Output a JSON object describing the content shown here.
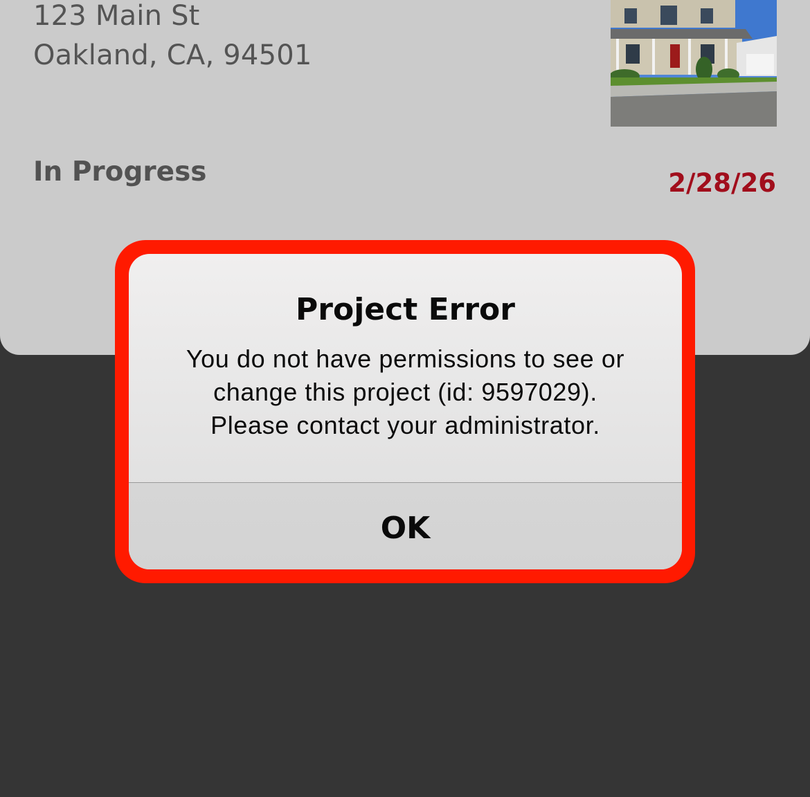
{
  "project_card": {
    "address_line1": "123 Main St",
    "address_line2": "Oakland, CA, 94501",
    "status": "In Progress",
    "due_date": "2/28/26",
    "due_date_color": "#a10e1c",
    "thumbnail": "house-photo"
  },
  "dialog": {
    "title": "Project Error",
    "message_line1": "You do not have permissions to see or",
    "message_line2": "change this project (id: 9597029).",
    "message_line3": "Please contact your administrator.",
    "ok_label": "OK",
    "highlight_color": "#ff1a00"
  }
}
